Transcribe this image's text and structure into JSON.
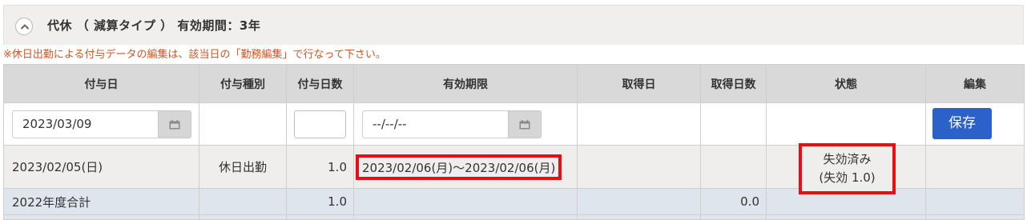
{
  "section": {
    "title": "代休 （ 減算タイプ ） 有効期間：3年",
    "notice": "※休日出勤による付与データの編集は、該当日の「勤務編集」で行なって下さい。"
  },
  "table": {
    "headers": [
      "付与日",
      "付与種別",
      "付与日数",
      "有効期限",
      "取得日",
      "取得日数",
      "状態",
      "編集"
    ],
    "input_row": {
      "grant_date_value": "2023/03/09",
      "days_value": "",
      "expiry_placeholder": "--/--/--",
      "save_label": "保存"
    },
    "data_row": {
      "grant_date": "2023/02/05(日)",
      "grant_type": "休日出勤",
      "grant_days": "1.0",
      "validity_period": "2023/02/06(月)～2023/02/06(月)",
      "used_date": "",
      "used_days": "",
      "status_line1": "失効済み",
      "status_line2": "(失効 1.0)"
    },
    "total_row": {
      "label": "2022年度合計",
      "grant_days": "1.0",
      "used_days": "0.0"
    }
  },
  "colors": {
    "highlight": "#e80f13",
    "notice": "#d9531e",
    "primary_button": "#2b61c9"
  }
}
